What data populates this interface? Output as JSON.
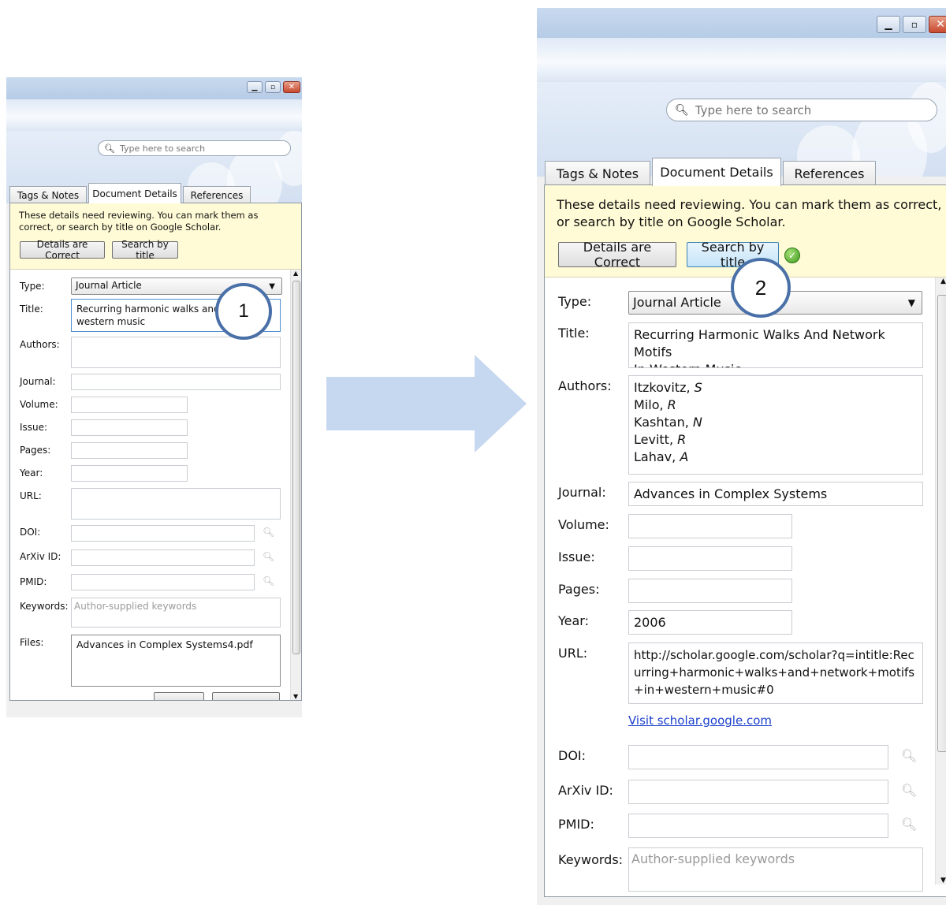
{
  "search": {
    "placeholder": "Type here to search"
  },
  "tabs": [
    "Tags & Notes",
    "Document Details",
    "References"
  ],
  "notice": {
    "message": "These details need reviewing. You can mark them as correct, or search by title on Google Scholar.",
    "correct_button": "Details are Correct",
    "search_button": "Search by title"
  },
  "labels": {
    "type": "Type:",
    "title": "Title:",
    "authors": "Authors:",
    "journal": "Journal:",
    "volume": "Volume:",
    "issue": "Issue:",
    "pages": "Pages:",
    "year": "Year:",
    "url": "URL:",
    "doi": "DOI:",
    "arxiv": "ArXiv ID:",
    "pmid": "PMID:",
    "keywords": "Keywords:",
    "files": "Files:"
  },
  "before": {
    "callout": "1",
    "type": "Journal Article",
    "title": "Recurring harmonic walks and ne\nwestern music",
    "keywords_placeholder": "Author-supplied keywords",
    "file": "Advances in Complex Systems4.pdf"
  },
  "after": {
    "callout": "2",
    "type": "Journal Article",
    "title": "Recurring Harmonic Walks And Network Motifs\nIn Western Music",
    "authors": [
      {
        "last": "Itzkovitz",
        "initial": "S"
      },
      {
        "last": "Milo",
        "initial": "R"
      },
      {
        "last": "Kashtan",
        "initial": "N"
      },
      {
        "last": "Levitt",
        "initial": "R"
      },
      {
        "last": "Lahav",
        "initial": "A"
      }
    ],
    "journal": "Advances in Complex Systems",
    "year": "2006",
    "url": "http://scholar.google.com/scholar?q=intitle:Rec\nurring+harmonic+walks+and+network+motifs\n+in+western+music#0",
    "visit_link": "Visit scholar.google.com",
    "keywords_placeholder": "Author-supplied keywords"
  },
  "colors": {
    "arrow": "#c6d8ef",
    "callout_border": "#4a70a8",
    "notice_bg": "#fffbd6",
    "link": "#1a3fcc"
  },
  "icons": {
    "search": "magnifier-icon",
    "check": "check-icon"
  }
}
